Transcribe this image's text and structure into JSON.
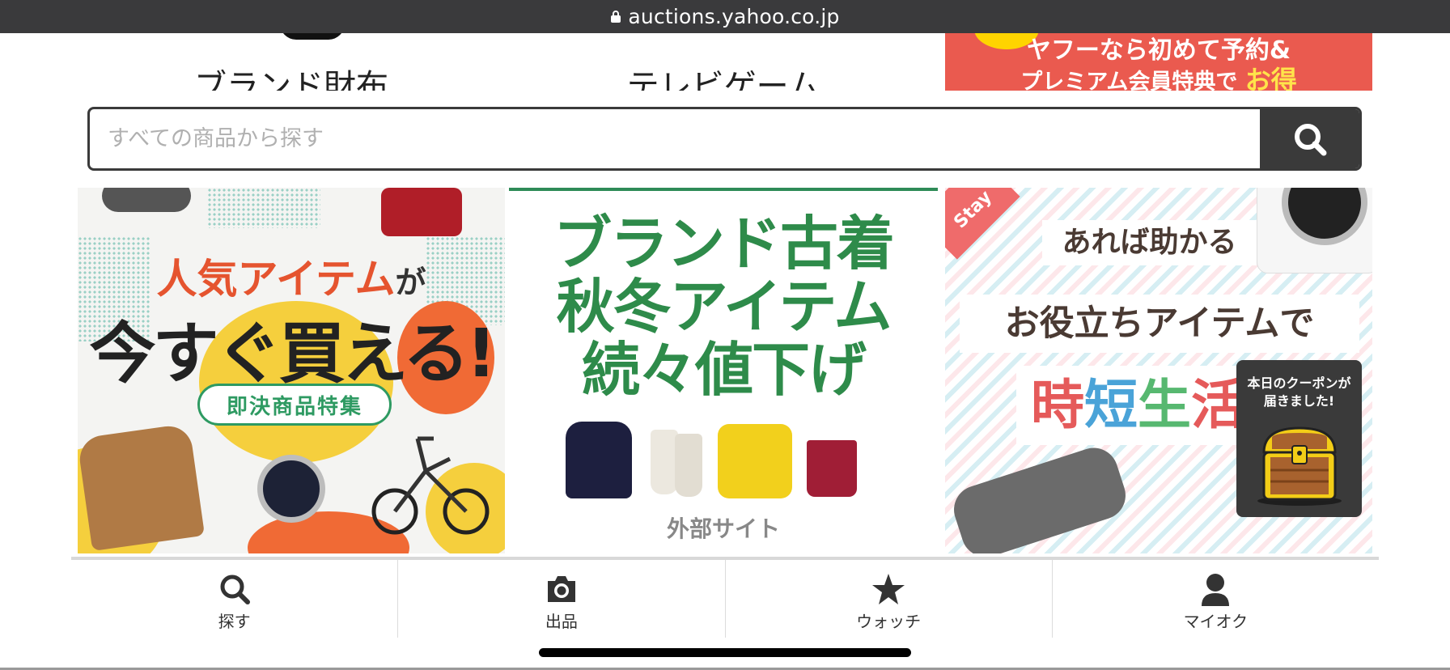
{
  "browser": {
    "url": "auctions.yahoo.co.jp"
  },
  "top_banners": [
    {
      "label": "ブランド財布"
    },
    {
      "label": "テレビゲーム"
    },
    {
      "line1": "ヤフーなら初めて予約&",
      "line2": "プレミアム会員特典で",
      "highlight": "お得"
    }
  ],
  "search": {
    "placeholder": "すべての商品から探す",
    "value": ""
  },
  "banners": {
    "b1": {
      "headline_colored": "人気アイテム",
      "headline_suffix": "が",
      "headline_main": "今すぐ買える!",
      "pill": "即決商品特集"
    },
    "b2": {
      "title_line1": "ブランド古着",
      "title_line2": "秋冬アイテム",
      "title_line3": "続々値下げ",
      "external": "外部サイト"
    },
    "b3": {
      "tag": "Stay",
      "line1": "あれば助かる",
      "line2": "お役立ちアイテムで",
      "line3_a": "時",
      "line3_b": "短",
      "line3_c": "生",
      "line3_d": "活"
    }
  },
  "coupon": {
    "line1": "本日のクーポンが",
    "line2": "届きました!",
    "icon": "treasure-chest-icon"
  },
  "bottom_nav": [
    {
      "label": "探す",
      "icon": "search-icon"
    },
    {
      "label": "出品",
      "icon": "camera-icon"
    },
    {
      "label": "ウォッチ",
      "icon": "star-icon"
    },
    {
      "label": "マイオク",
      "icon": "person-icon"
    }
  ],
  "colors": {
    "dark": "#3a3a3a",
    "green": "#2e8b4a",
    "red": "#e5542f"
  }
}
